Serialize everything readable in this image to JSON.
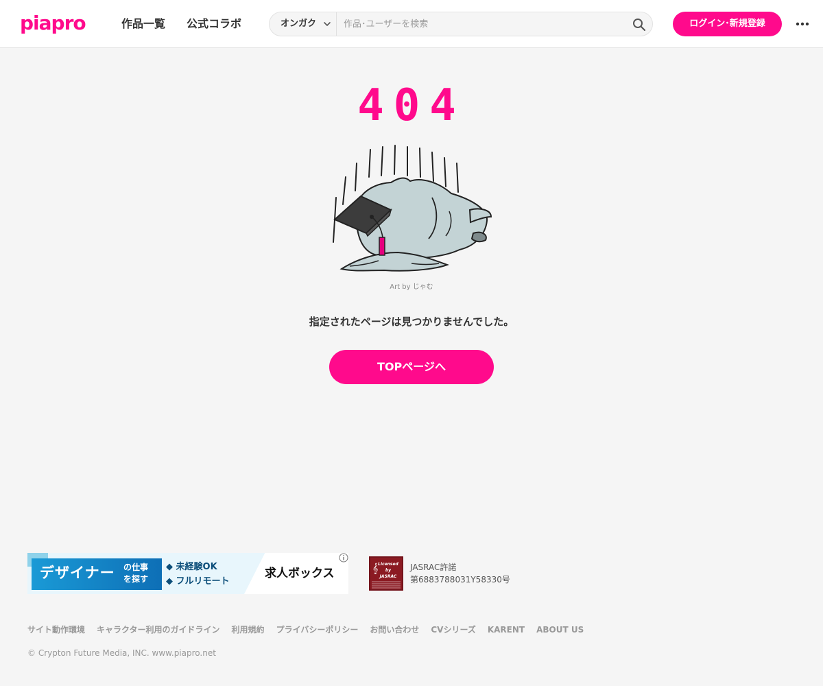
{
  "header": {
    "logo": "piapro",
    "nav": [
      {
        "label": "作品一覧"
      },
      {
        "label": "公式コラボ"
      }
    ],
    "search": {
      "category": "オンガク",
      "placeholder": "作品･ユーザーを検索"
    },
    "login_label": "ログイン･新規登録"
  },
  "main": {
    "code": "404",
    "credit": "Art by じゃむ",
    "message": "指定されたページは見つかりませんでした。",
    "top_button": "TOPページへ"
  },
  "footer": {
    "ad": {
      "title": "デザイナー",
      "sub": "の仕事を探す",
      "points": [
        "◆ 未経験OK",
        "◆ フルリモート"
      ],
      "brand": "求人ボックス"
    },
    "jasrac": {
      "logo_text": "Licensed by JASRAC",
      "line1": "JASRAC許諾",
      "line2": "第6883788031Y58330号"
    },
    "links": [
      "サイト動作環境",
      "キャラクター利用のガイドライン",
      "利用規約",
      "プライバシーポリシー",
      "お問い合わせ",
      "CVシリーズ",
      "KARENT",
      "ABOUT US"
    ],
    "copyright": "© Crypton Future Media, INC. www.piapro.net"
  },
  "colors": {
    "accent": "#ff0a8c",
    "background": "#f5f5f5",
    "header_bg": "#ffffff"
  }
}
